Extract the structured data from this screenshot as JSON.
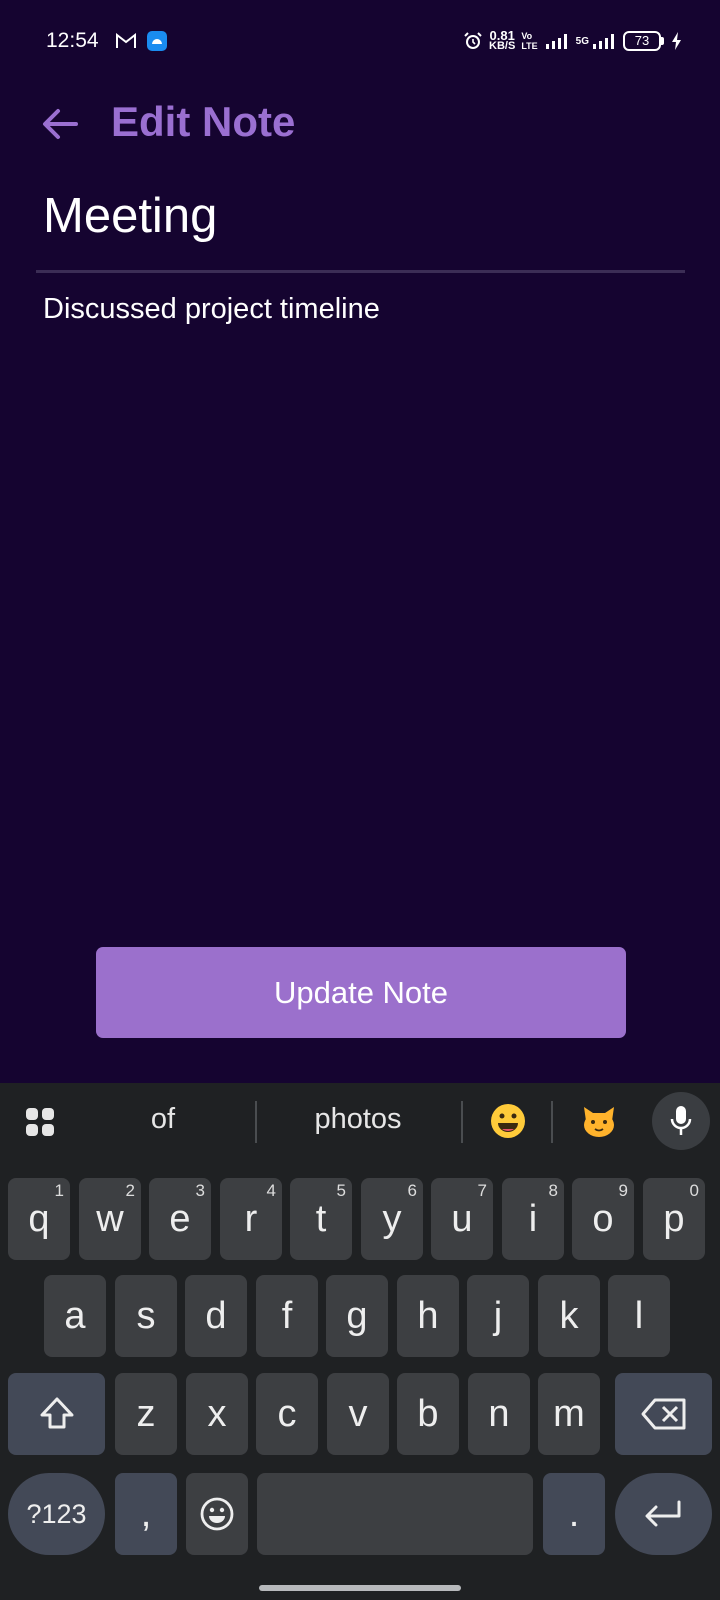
{
  "status_bar": {
    "time": "12:54",
    "left_icons": [
      "gmail-icon",
      "android-icon"
    ],
    "net_speed_value": "0.81",
    "net_speed_unit": "KB/S",
    "volte_top": "Vo",
    "volte_bottom": "LTE",
    "network": "5G",
    "battery": "73"
  },
  "header": {
    "back_icon": "arrow-left-icon",
    "title": "Edit Note",
    "accent_color": "#9a6fd1"
  },
  "note": {
    "title_value": "Meeting",
    "body_value": "Discussed project timeline"
  },
  "actions": {
    "update_label": "Update Note",
    "button_color": "#9b70cc"
  },
  "keyboard": {
    "suggestions": [
      "of",
      "photos"
    ],
    "emoji_suggestions": [
      "grinning-face",
      "cat-face"
    ],
    "rows": [
      [
        {
          "k": "q",
          "h": "1"
        },
        {
          "k": "w",
          "h": "2"
        },
        {
          "k": "e",
          "h": "3"
        },
        {
          "k": "r",
          "h": "4"
        },
        {
          "k": "t",
          "h": "5"
        },
        {
          "k": "y",
          "h": "6"
        },
        {
          "k": "u",
          "h": "7"
        },
        {
          "k": "i",
          "h": "8"
        },
        {
          "k": "o",
          "h": "9"
        },
        {
          "k": "p",
          "h": "0"
        }
      ],
      [
        {
          "k": "a"
        },
        {
          "k": "s"
        },
        {
          "k": "d"
        },
        {
          "k": "f"
        },
        {
          "k": "g"
        },
        {
          "k": "h"
        },
        {
          "k": "j"
        },
        {
          "k": "k"
        },
        {
          "k": "l"
        }
      ],
      [
        {
          "k": "z"
        },
        {
          "k": "x"
        },
        {
          "k": "c"
        },
        {
          "k": "v"
        },
        {
          "k": "b"
        },
        {
          "k": "n"
        },
        {
          "k": "m"
        }
      ]
    ],
    "symbols_label": "?123",
    "comma": ",",
    "period": "."
  },
  "colors": {
    "background": "#150430",
    "keyboard_bg": "#1f2123"
  }
}
